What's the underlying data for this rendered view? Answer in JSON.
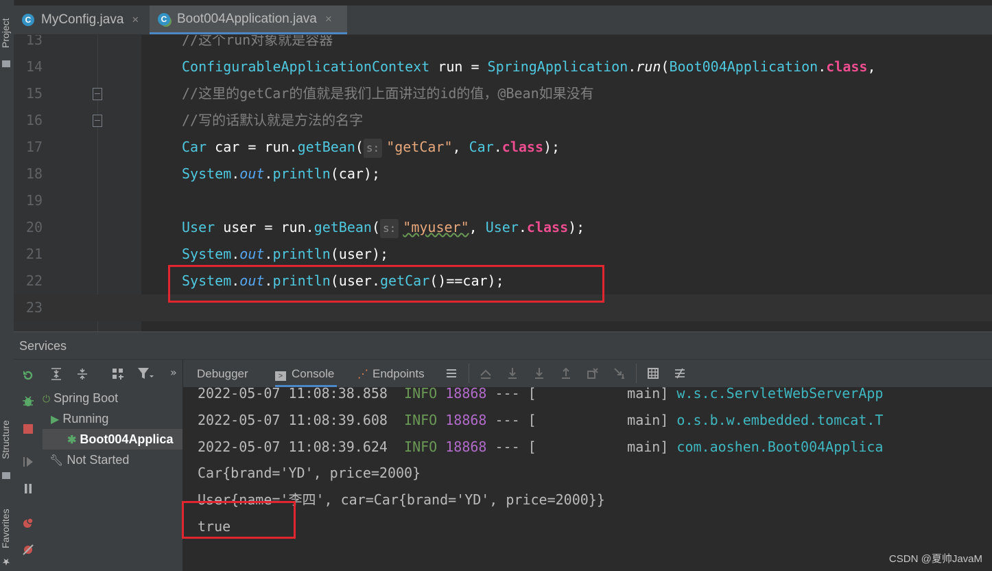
{
  "side_strip": {
    "project_label": "Project",
    "structure_label": "Structure",
    "favorites_label": "Favorites"
  },
  "tabs": [
    {
      "label": "MyConfig.java",
      "icon": "class-icon",
      "active": false
    },
    {
      "label": "Boot004Application.java",
      "icon": "spring-boot-class-icon",
      "active": true
    }
  ],
  "editor": {
    "lines": [
      {
        "num": "13",
        "code": [
          {
            "t": "//这个run对象就是容器",
            "c": "cm"
          }
        ]
      },
      {
        "num": "14",
        "code": [
          {
            "t": "ConfigurableApplicationContext",
            "c": "ty"
          },
          {
            "t": " run = ",
            "c": "pl"
          },
          {
            "t": "SpringApplication",
            "c": "ty"
          },
          {
            "t": ".",
            "c": "pl"
          },
          {
            "t": "run",
            "c": "pl-i"
          },
          {
            "t": "(",
            "c": "pl"
          },
          {
            "t": "Boot004Application",
            "c": "ty"
          },
          {
            "t": ".",
            "c": "pl"
          },
          {
            "t": "class",
            "c": "kw"
          },
          {
            "t": ",",
            "c": "pl"
          }
        ]
      },
      {
        "num": "15",
        "code": [
          {
            "t": "//这里的getCar的值就是我们上面讲过的id的值，@Bean如果没有",
            "c": "cm"
          }
        ]
      },
      {
        "num": "16",
        "code": [
          {
            "t": "//写的话默认就是方法的名字",
            "c": "cm"
          }
        ]
      },
      {
        "num": "17",
        "code": [
          {
            "t": "Car",
            "c": "ty"
          },
          {
            "t": " car = run.",
            "c": "pl"
          },
          {
            "t": "getBean",
            "c": "mt"
          },
          {
            "t": "(",
            "c": "pl"
          },
          {
            "t": "s:",
            "c": "hint"
          },
          {
            "t": "\"getCar\"",
            "c": "st"
          },
          {
            "t": ", ",
            "c": "pl"
          },
          {
            "t": "Car",
            "c": "ty"
          },
          {
            "t": ".",
            "c": "pl"
          },
          {
            "t": "class",
            "c": "kw"
          },
          {
            "t": ");",
            "c": "pl"
          }
        ]
      },
      {
        "num": "18",
        "code": [
          {
            "t": "System",
            "c": "ty"
          },
          {
            "t": ".",
            "c": "pl"
          },
          {
            "t": "out",
            "c": "fld"
          },
          {
            "t": ".",
            "c": "pl"
          },
          {
            "t": "println",
            "c": "mt"
          },
          {
            "t": "(car);",
            "c": "pl"
          }
        ]
      },
      {
        "num": "19",
        "code": []
      },
      {
        "num": "20",
        "code": [
          {
            "t": "User",
            "c": "ty"
          },
          {
            "t": " user = run.",
            "c": "pl"
          },
          {
            "t": "getBean",
            "c": "mt"
          },
          {
            "t": "(",
            "c": "pl"
          },
          {
            "t": "s:",
            "c": "hint"
          },
          {
            "t": "\"myuser\"",
            "c": "st-w"
          },
          {
            "t": ", ",
            "c": "pl"
          },
          {
            "t": "User",
            "c": "ty"
          },
          {
            "t": ".",
            "c": "pl"
          },
          {
            "t": "class",
            "c": "kw"
          },
          {
            "t": ");",
            "c": "pl"
          }
        ]
      },
      {
        "num": "21",
        "code": [
          {
            "t": "System",
            "c": "ty"
          },
          {
            "t": ".",
            "c": "pl"
          },
          {
            "t": "out",
            "c": "fld"
          },
          {
            "t": ".",
            "c": "pl"
          },
          {
            "t": "println",
            "c": "mt"
          },
          {
            "t": "(user);",
            "c": "pl"
          }
        ]
      },
      {
        "num": "22",
        "code": [
          {
            "t": "System",
            "c": "ty"
          },
          {
            "t": ".",
            "c": "pl"
          },
          {
            "t": "out",
            "c": "fld"
          },
          {
            "t": ".",
            "c": "pl"
          },
          {
            "t": "println",
            "c": "mt"
          },
          {
            "t": "(user.",
            "c": "pl"
          },
          {
            "t": "getCar",
            "c": "mt"
          },
          {
            "t": "()==car);",
            "c": "pl"
          }
        ]
      },
      {
        "num": "23",
        "code": []
      }
    ]
  },
  "services": {
    "title": "Services",
    "tree": [
      {
        "label": "Spring Boot",
        "icon": "spring-boot-icon",
        "depth": 0
      },
      {
        "label": "Running",
        "icon": "run-arrow-icon",
        "depth": 1
      },
      {
        "label": "Boot004Applica",
        "icon": "bug-run-icon",
        "depth": 2,
        "selected": true
      },
      {
        "label": "Not Started",
        "icon": "wrench-icon",
        "depth": 1
      }
    ],
    "toolbar_more": "»",
    "console_tabs": [
      {
        "label": "Debugger",
        "icon": ""
      },
      {
        "label": "Console",
        "icon": "console-icon",
        "active": true
      },
      {
        "label": "Endpoints",
        "icon": "endpoints-icon"
      }
    ],
    "console_lines": [
      {
        "ts": "2022-05-07 11:08:38.858",
        "level": "INFO",
        "pid": "18868",
        "mid": " --- [",
        "thread": "           main]",
        "logger": "w.s.c.ServletWebServerApp"
      },
      {
        "ts": "2022-05-07 11:08:39.608",
        "level": "INFO",
        "pid": "18868",
        "mid": " --- [",
        "thread": "           main]",
        "logger": "o.s.b.w.embedded.tomcat.T"
      },
      {
        "ts": "2022-05-07 11:08:39.624",
        "level": "INFO",
        "pid": "18868",
        "mid": " --- [",
        "thread": "           main]",
        "logger": "com.aoshen.Boot004Applica"
      }
    ],
    "output_lines": [
      "Car{brand='YD', price=2000}",
      "User{name='李四', car=Car{brand='YD', price=2000}}",
      "true"
    ]
  },
  "watermark": "CSDN @夏帅JavaM",
  "colors": {
    "highlight_box": "#e1262f",
    "accent": "#4a88c7"
  }
}
